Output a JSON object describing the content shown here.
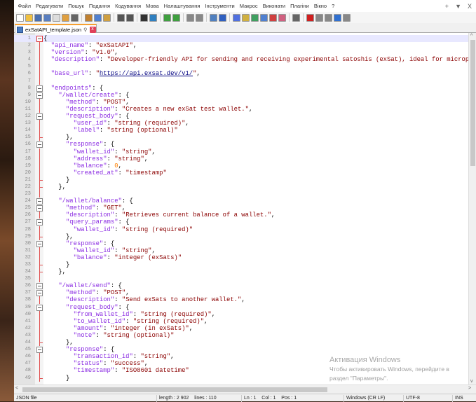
{
  "menu": [
    "Файл",
    "Редагувати",
    "Пошук",
    "Подання",
    "Кодування",
    "Мова",
    "Налаштування",
    "Інструменти",
    "Макрос",
    "Виконати",
    "Плагіни",
    "Вікно",
    "?"
  ],
  "window_controls": [
    "+",
    "▼",
    "X"
  ],
  "tab": {
    "title": "exSatAPI_template.json",
    "pin": "⚲",
    "close": "x"
  },
  "editor": {
    "current_line": 1,
    "lines": [
      "{",
      "  \"api_name\": \"exSatAPI\",",
      "  \"version\": \"v1.0\",",
      "  \"description\": \"Developer-friendly API for sending and receiving experimental satoshis (exSat), ideal for micropayment testin",
      "",
      "  \"base_url\": \"https://api.exsat.dev/v1/\",",
      "",
      "  \"endpoints\": {",
      "    \"/wallet/create\": {",
      "      \"method\": \"POST\",",
      "      \"description\": \"Creates a new exSat test wallet.\",",
      "      \"request_body\": {",
      "        \"user_id\": \"string (required)\",",
      "        \"label\": \"string (optional)\"",
      "      },",
      "      \"response\": {",
      "        \"wallet_id\": \"string\",",
      "        \"address\": \"string\",",
      "        \"balance\": 0,",
      "        \"created_at\": \"timestamp\"",
      "      }",
      "    },",
      "",
      "    \"/wallet/balance\": {",
      "      \"method\": \"GET\",",
      "      \"description\": \"Retrieves current balance of a wallet.\",",
      "      \"query_params\": {",
      "        \"wallet_id\": \"string (required)\"",
      "      },",
      "      \"response\": {",
      "        \"wallet_id\": \"string\",",
      "        \"balance\": \"integer (exSats)\"",
      "      }",
      "    },",
      "",
      "    \"/wallet/send\": {",
      "      \"method\": \"POST\",",
      "      \"description\": \"Send exSats to another wallet.\",",
      "      \"request_body\": {",
      "        \"from_wallet_id\": \"string (required)\",",
      "        \"to_wallet_id\": \"string (required)\",",
      "        \"amount\": \"integer (in exSats)\",",
      "        \"note\": \"string (optional)\"",
      "      },",
      "      \"response\": {",
      "        \"transaction_id\": \"string\",",
      "        \"status\": \"success\",",
      "        \"timestamp\": \"ISO8601 datetime\"",
      "      }"
    ]
  },
  "status": {
    "file_type": "JSON file",
    "length": "length : 2 902    lines : 110",
    "position": "Ln : 1    Col : 1    Pos : 1",
    "eol": "Windows (CR LF)",
    "encoding": "UTF-8",
    "mode": "INS"
  },
  "watermark": {
    "title": "Активация Windows",
    "line1": "Чтобы активировать Windows, перейдите в",
    "line2": "раздел \"Параметры\"."
  },
  "toolbar_icons": [
    "new",
    "open",
    "save",
    "save-all",
    "close",
    "close-all",
    "print",
    "cut",
    "copy",
    "paste",
    "undo",
    "redo",
    "find",
    "replace",
    "zoom-in",
    "zoom-out",
    "sync-v",
    "sync-h",
    "word-wrap",
    "show-all",
    "indent-guide",
    "udl",
    "doc-map",
    "func-list",
    "folder-workspace",
    "monitor",
    "record",
    "stop",
    "play",
    "play-multi",
    "save-macro",
    "run"
  ]
}
